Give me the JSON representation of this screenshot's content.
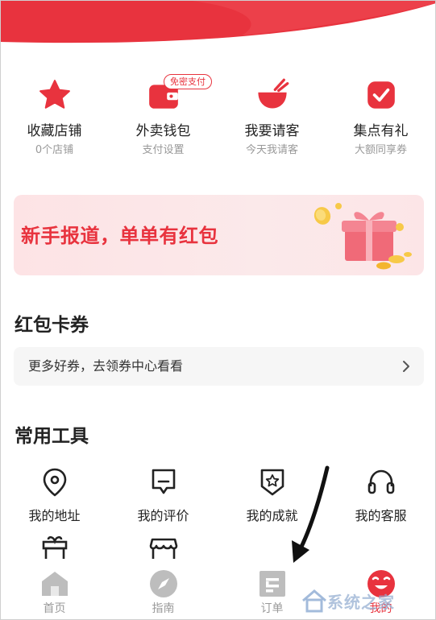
{
  "colors": {
    "accent": "#e8333e",
    "text_primary": "#222222",
    "text_secondary": "#999999",
    "tab_inactive": "#9a9a9a",
    "banner_bg": "#fde3e5"
  },
  "quick_actions": [
    {
      "label": "收藏店铺",
      "sub": "0个店铺",
      "icon": "star-icon"
    },
    {
      "label": "外卖钱包",
      "sub": "支付设置",
      "icon": "wallet-icon",
      "badge": "免密支付"
    },
    {
      "label": "我要请客",
      "sub": "今天我请客",
      "icon": "bowl-chopsticks-icon"
    },
    {
      "label": "集点有礼",
      "sub": "大额同享券",
      "icon": "check-badge-icon"
    }
  ],
  "banner": {
    "text": "新手报道，单单有红包",
    "icon": "gift-box-icon"
  },
  "coupons": {
    "title": "红包卡券",
    "link_text": "更多好券，去领券中心看看",
    "arrow_icon": "chevron-right-icon"
  },
  "tools": {
    "title": "常用工具",
    "items": [
      {
        "label": "我的地址",
        "icon": "location-pin-icon"
      },
      {
        "label": "我的评价",
        "icon": "comment-icon"
      },
      {
        "label": "我的成就",
        "icon": "achievement-badge-icon"
      },
      {
        "label": "我的客服",
        "icon": "headset-icon"
      }
    ],
    "row2_icons": [
      "gift-icon",
      "shop-icon"
    ]
  },
  "tabbar": {
    "items": [
      {
        "label": "首页",
        "icon": "home-icon",
        "active": false
      },
      {
        "label": "指南",
        "icon": "compass-icon",
        "active": false
      },
      {
        "label": "订单",
        "icon": "order-list-icon",
        "active": false
      },
      {
        "label": "我的",
        "icon": "profile-face-icon",
        "active": true
      }
    ]
  },
  "watermark": {
    "text": "系统之家"
  }
}
